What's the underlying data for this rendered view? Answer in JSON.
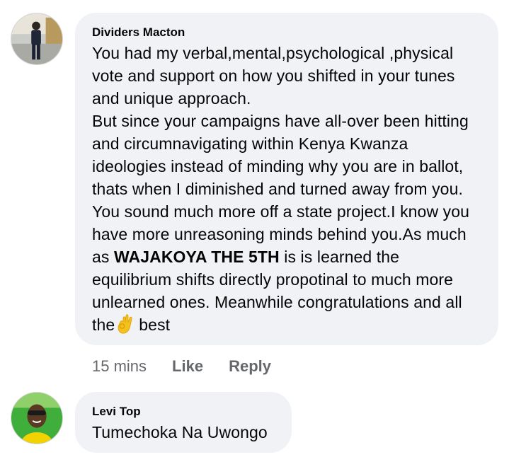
{
  "comments": [
    {
      "author": "Dividers Macton",
      "paragraph1": "You had my verbal,mental,psychological ,physical vote and support on how you shifted in your tunes and unique approach.",
      "paragraph2_part1": "But since your campaigns have all-over been hitting and circumnavigating within Kenya Kwanza ideologies instead of minding why you are in ballot, thats when I diminished and turned away from you. You sound much more off a state project.I know you have more unreasoning minds behind you.As much as ",
      "paragraph2_bold": "WAJAKOYA THE 5TH",
      "paragraph2_part2": " is is learned the equilibrium shifts directly propotinal to much more unlearned ones. Meanwhile congratulations and all the",
      "emoji": "ok-hand-icon",
      "paragraph2_end": "best",
      "time": "15 mins",
      "like_label": "Like",
      "reply_label": "Reply"
    },
    {
      "author": "Levi Top",
      "text": "Tumechoka Na Uwongo"
    }
  ],
  "colors": {
    "bubble_bg": "#f0f2f5",
    "text": "#050505",
    "meta": "#65676b"
  }
}
